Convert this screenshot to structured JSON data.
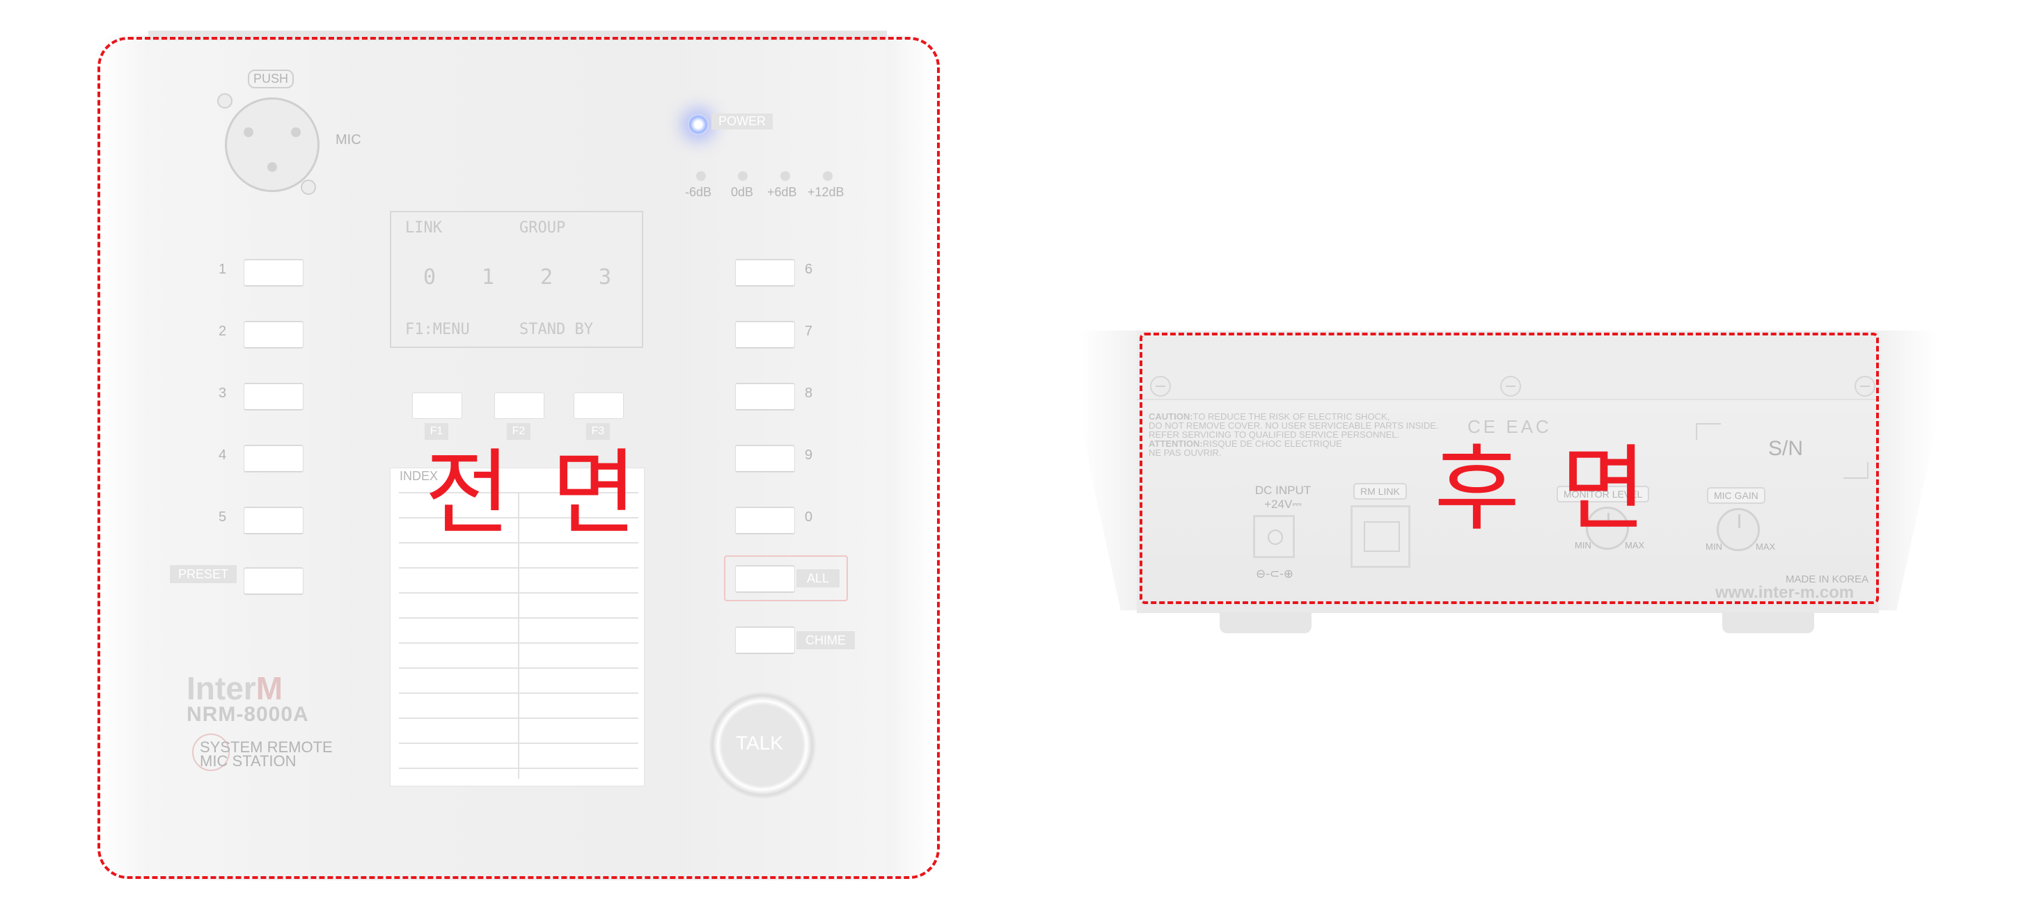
{
  "front": {
    "caption": "전 면",
    "push_label": "PUSH",
    "mic_label": "MIC",
    "power_label": "POWER",
    "levels": [
      "-6dB",
      "0dB",
      "+6dB",
      "+12dB"
    ],
    "lcd": {
      "link": "LINK",
      "group": "GROUP",
      "values": [
        "0",
        "1",
        "2",
        "3"
      ],
      "menu": "F1:MENU",
      "status": "STAND BY"
    },
    "left_keys": [
      "1",
      "2",
      "3",
      "4",
      "5"
    ],
    "right_keys": [
      "6",
      "7",
      "8",
      "9",
      "0"
    ],
    "preset_label": "PRESET",
    "all_label": "ALL",
    "chime_label": "CHIME",
    "fkeys": [
      "F1",
      "F2",
      "F3"
    ],
    "index_label": "INDEX",
    "brand": {
      "logo_prefix": "Inter",
      "logo_suffix": "M",
      "model": "NRM-8000A",
      "desc_line1": "SYSTEM REMOTE",
      "desc_line2": "MIC STATION"
    },
    "talk_label": "TALK"
  },
  "rear": {
    "caption": "후 면",
    "caution": {
      "line1_bold": "CAUTION:",
      "line1": "TO REDUCE THE RISK OF ELECTRIC SHOCK,",
      "line2": "DO NOT REMOVE COVER. NO USER SERVICEABLE PARTS INSIDE.",
      "line3": "REFER SERVICING TO QUALIFIED SERVICE PERSONNEL.",
      "line4_bold": "ATTENTION:",
      "line4": "RISQUE DE CHOC ELECTRIQUE",
      "line5": "NE PAS OUVRIR."
    },
    "cert_marks": "CE EAC",
    "sn_label": "S/N",
    "dc_input": "DC INPUT",
    "dc_voltage": "+24V⎓",
    "dc_polarity": "⊖-⊂-⊕",
    "rm_link": "RM LINK",
    "monitor_level": "MONITOR LEVEL",
    "mic_gain": "MIC GAIN",
    "min": "MIN",
    "max": "MAX",
    "made_in": "MADE IN KOREA",
    "website": "www.inter-m.com"
  },
  "colors": {
    "annotation_red": "#e8151b",
    "power_led_blue": "#9bb4ff"
  }
}
